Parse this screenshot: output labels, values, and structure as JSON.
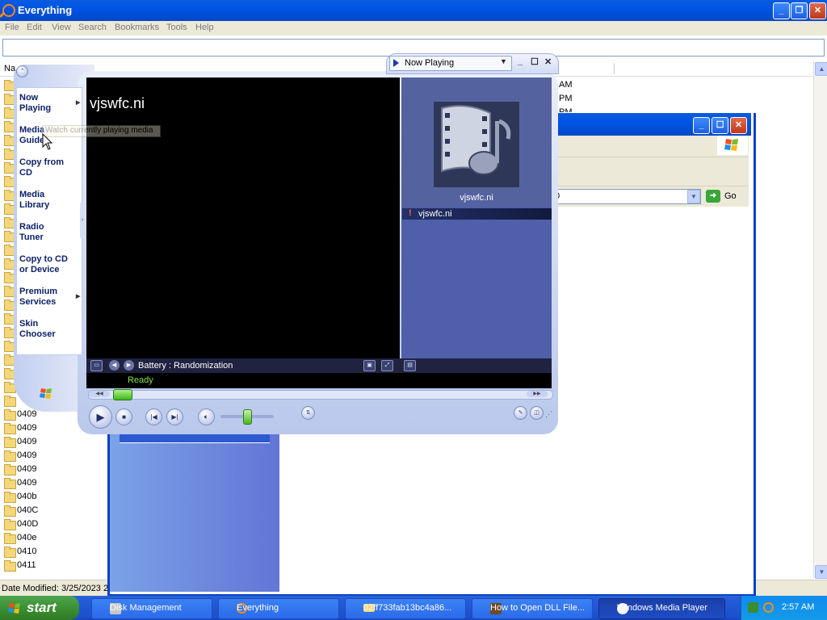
{
  "everything": {
    "title": "Everything",
    "menu": [
      "File",
      "Edit",
      "View",
      "Search",
      "Bookmarks",
      "Tools",
      "Help"
    ],
    "col_name": "Na",
    "rows": [
      "0409",
      "0409",
      "0409",
      "0409",
      "0409",
      "0409",
      "040b",
      "040C",
      "040D",
      "040e",
      "0410",
      "0411"
    ],
    "times": [
      "AM",
      "PM",
      "PM"
    ],
    "status": "Date Modified: 3/25/2023 2"
  },
  "explorer": {
    "address_value": "0",
    "go_label": "Go"
  },
  "wmp": {
    "dropdown_label": "Now Playing",
    "tasks": [
      {
        "label": "Now\nPlaying",
        "has_arrow": true
      },
      {
        "label": "Media\nGuide",
        "has_arrow": false
      },
      {
        "label": "Copy from\nCD",
        "has_arrow": false
      },
      {
        "label": "Media\nLibrary",
        "has_arrow": false
      },
      {
        "label": "Radio\nTuner",
        "has_arrow": false
      },
      {
        "label": "Copy to CD\nor Device",
        "has_arrow": false
      },
      {
        "label": "Premium\nServices",
        "has_arrow": true
      },
      {
        "label": "Skin\nChooser",
        "has_arrow": false
      }
    ],
    "tooltip": "Watch currently playing media",
    "video_title": "vjswfc.ni",
    "art_name": "vjswfc.ni",
    "playlist_item": "vjswfc.ni",
    "playlist_warning": "!",
    "info_text": "Battery : Randomization",
    "status_text": "Ready",
    "seek_position": 0.07,
    "volume_level": 0.45
  },
  "taskbar": {
    "start_label": "start",
    "items": [
      {
        "label": "Disk Management",
        "active": false
      },
      {
        "label": "Everything",
        "active": false
      },
      {
        "label": "02ff733fab13bc4a86...",
        "active": false
      },
      {
        "label": "How to Open DLL File...",
        "active": false
      },
      {
        "label": "Windows Media Player",
        "active": true
      }
    ],
    "clock": "2:57 AM"
  },
  "colors": {
    "xp_blue": "#0054e3",
    "wmp_panel": "#4f5faa",
    "ready_green": "#80e050",
    "start_green": "#3a8c2f"
  }
}
